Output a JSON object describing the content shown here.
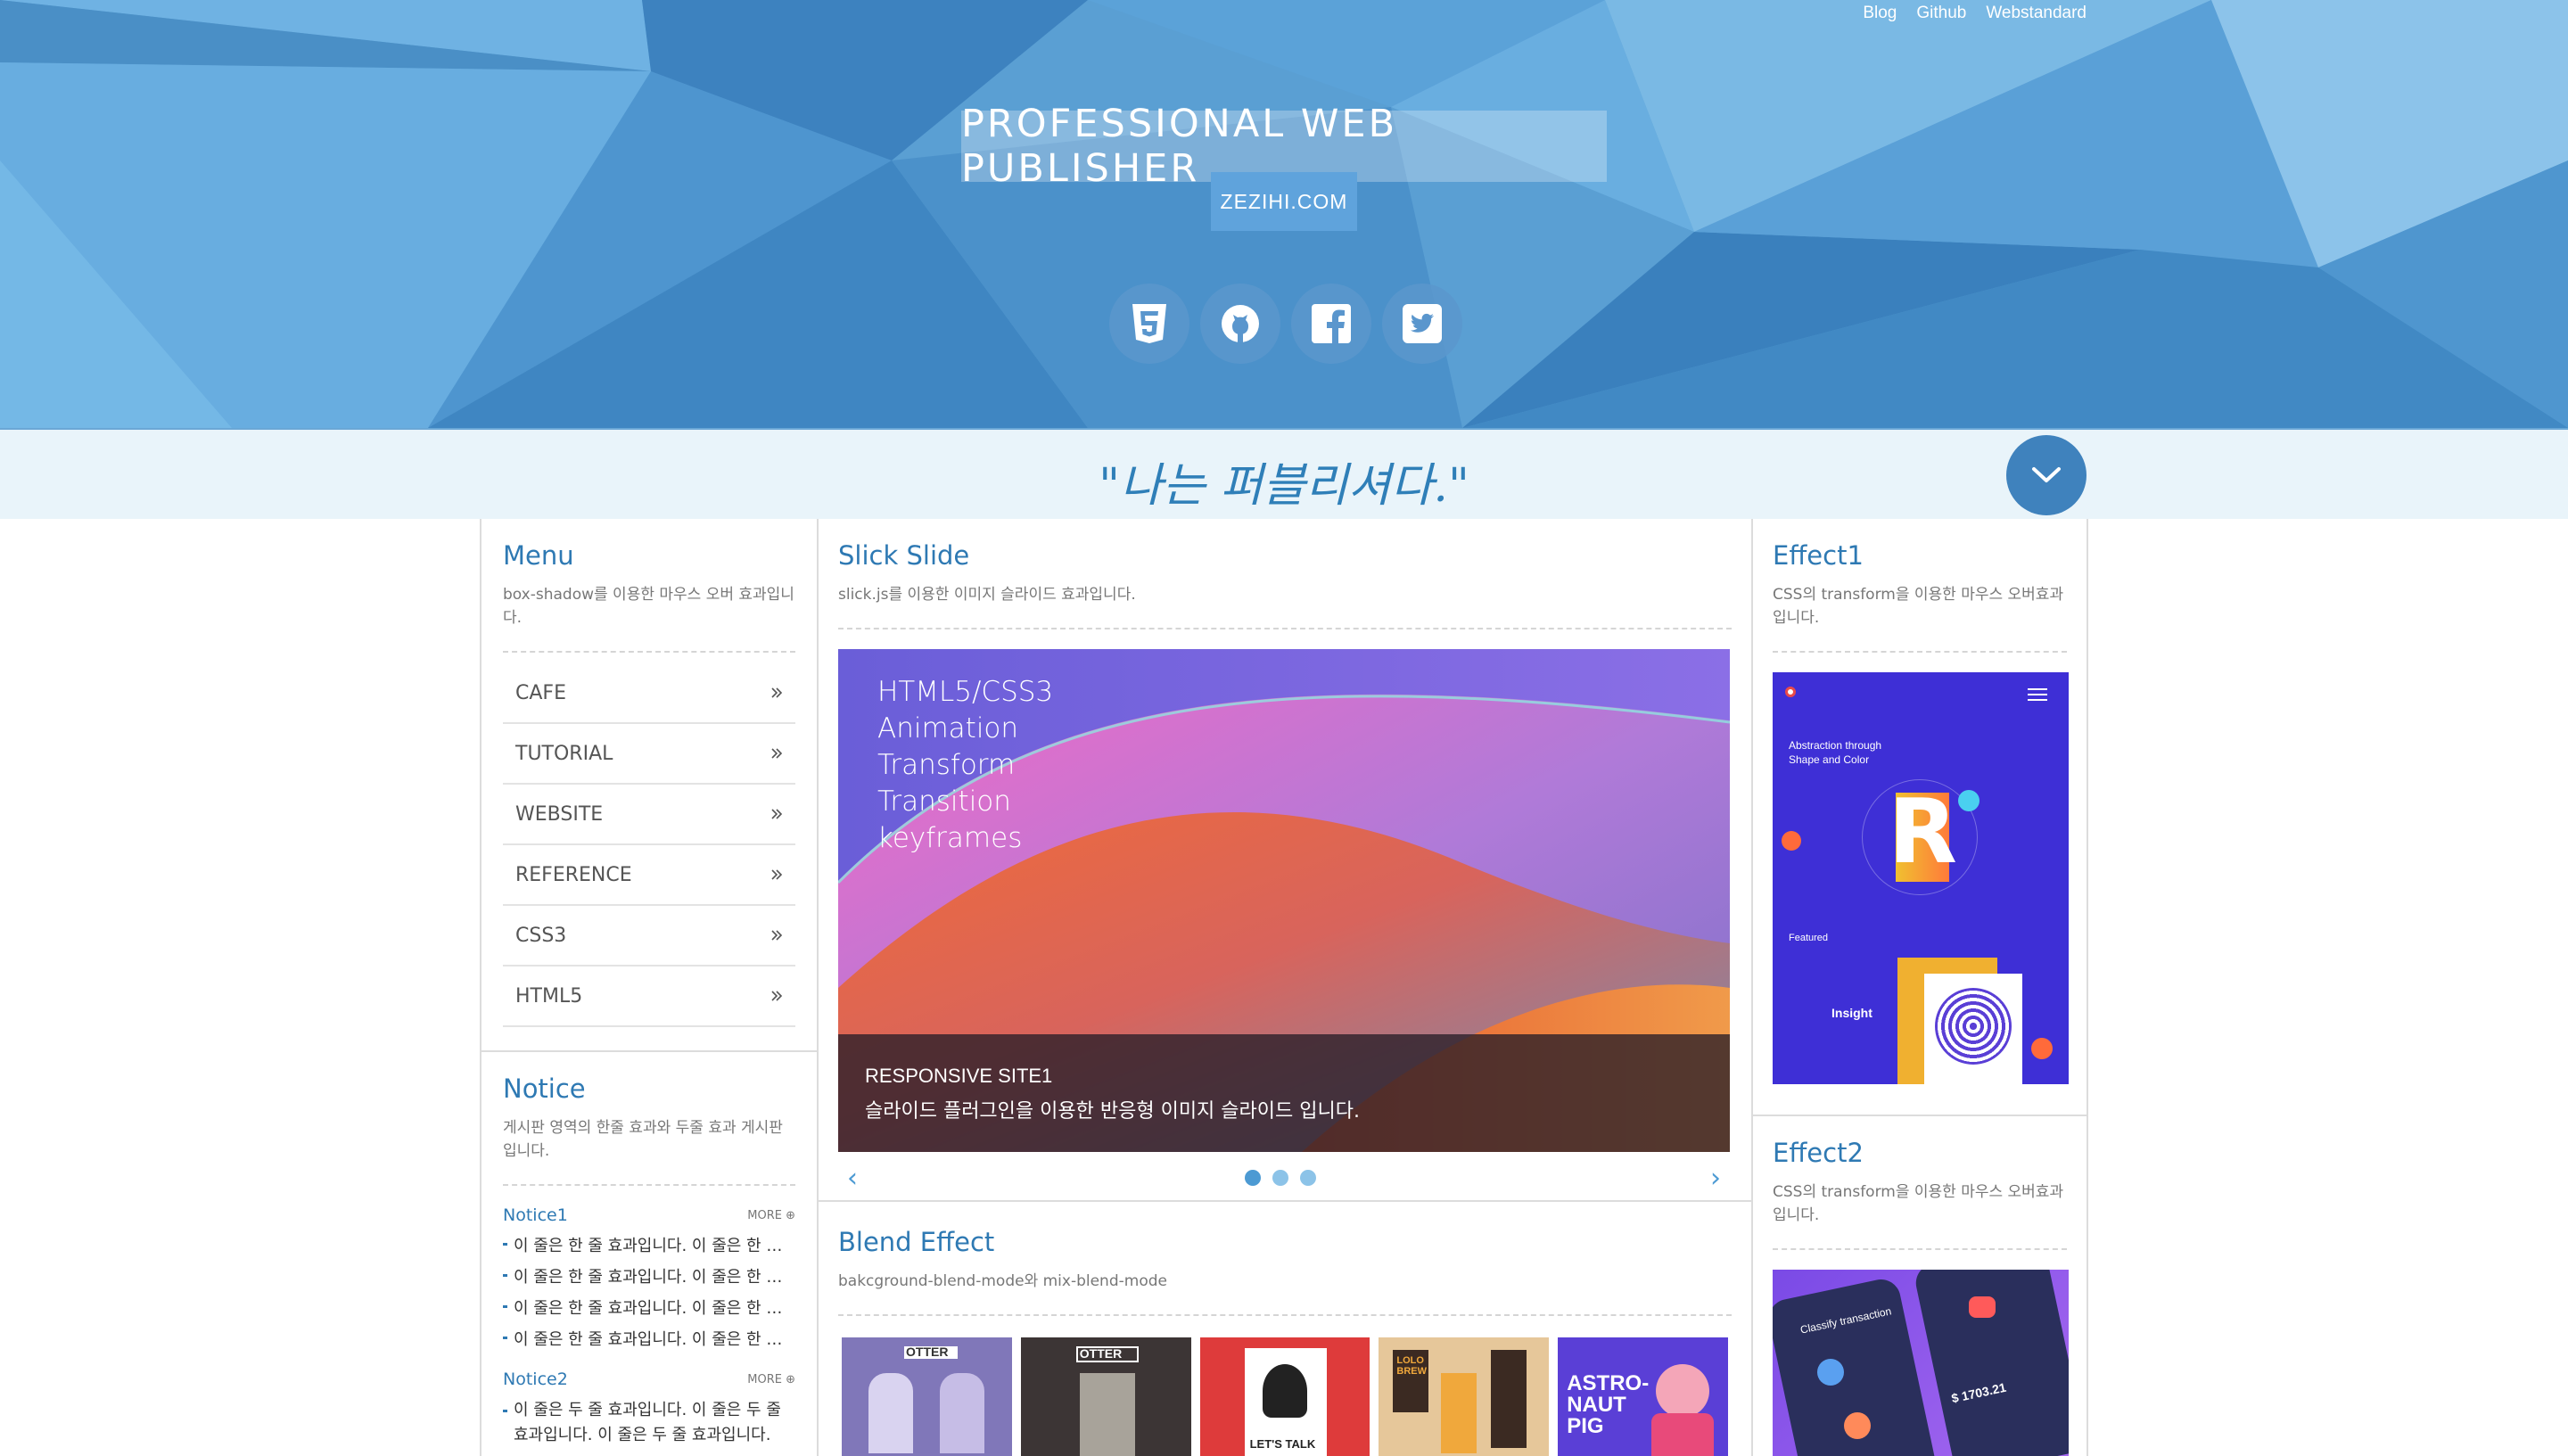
{
  "header": {
    "links": [
      "Blog",
      "Github",
      "Webstandard"
    ],
    "title": "PROFESSIONAL WEB PUBLISHER",
    "site": "ZEZIHI.COM",
    "social_icons": [
      "html5-icon",
      "github-icon",
      "facebook-icon",
      "twitter-icon"
    ]
  },
  "quote": "\"나는 퍼블리셔다.\"",
  "menu": {
    "title": "Menu",
    "desc": "box-shadow를 이용한 마우스 오버 효과입니다.",
    "items": [
      "CAFE",
      "TUTORIAL",
      "WEBSITE",
      "REFERENCE",
      "CSS3",
      "HTML5"
    ]
  },
  "notice": {
    "title": "Notice",
    "desc": "게시판 영역의 한줄 효과와 두줄 효과 게시판입니다.",
    "notice1": {
      "label": "Notice1",
      "more": "MORE",
      "lines": [
        "이 줄은 한 줄 효과입니다. 이 줄은 한 줄 효과입니다.",
        "이 줄은 한 줄 효과입니다. 이 줄은 한 줄 효과입니다.",
        "이 줄은 한 줄 효과입니다. 이 줄은 한 줄 효과입니다.",
        "이 줄은 한 줄 효과입니다. 이 줄은 한 줄 효과입니다."
      ]
    },
    "notice2": {
      "label": "Notice2",
      "more": "MORE",
      "text": "이 줄은 두 줄 효과입니다. 이 줄은 두 줄 효과입니다. 이 줄은 두 줄 효과입니다."
    }
  },
  "slick": {
    "title": "Slick Slide",
    "desc": "slick.js를 이용한 이미지 슬라이드 효과입니다.",
    "slide_lines": [
      "HTML5/CSS3",
      "Animation",
      "Transform",
      "Transition",
      "keyframes"
    ],
    "caption_title": "RESPONSIVE SITE1",
    "caption_text": "슬라이드 플러그인을 이용한 반응형 이미지 슬라이드 입니다.",
    "dots": 3,
    "active_dot": 0
  },
  "blend": {
    "title": "Blend Effect",
    "desc": "bakcground-blend-mode와 mix-blend-mode",
    "items": [
      {
        "label": "OTTER",
        "color": "#7a6fb0"
      },
      {
        "label": "OTTER",
        "color": "#3c3535"
      },
      {
        "label": "LET'S TALK",
        "color": "#d93a3a"
      },
      {
        "label": "LOLO BREW",
        "color": "#e6c79a"
      },
      {
        "label": "ASTRO-NAUT PIG",
        "color": "#5a3fd6"
      }
    ]
  },
  "effect1": {
    "title": "Effect1",
    "desc": "CSS의 transform을 이용한 마우스 오버효과 입니다.",
    "img_lines": [
      "Abstraction through",
      "Shape and Color",
      "Featured",
      "Insight"
    ]
  },
  "effect2": {
    "title": "Effect2",
    "desc": "CSS의 transform을 이용한 마우스 오버효과 입니다.",
    "img_lines": [
      "Classify transaction",
      "$ 1703.21"
    ]
  },
  "colors": {
    "accent": "#2e79b3",
    "header_bg": "#5a9fd3",
    "quote_bg": "#e9f4fa"
  }
}
